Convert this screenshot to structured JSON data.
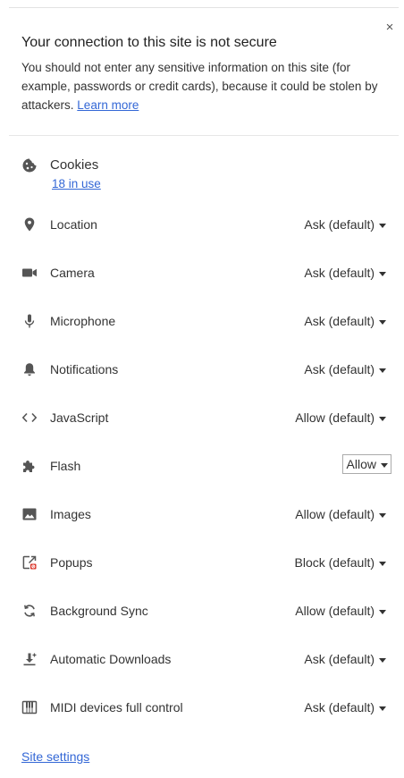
{
  "header": {
    "close_glyph": "×",
    "title": "Your connection to this site is not secure",
    "description": "You should not enter any sensitive information on this site (for example, passwords or credit cards), because it could be stolen by attackers.",
    "learn_more": "Learn more"
  },
  "cookies": {
    "label": "Cookies",
    "in_use": "18 in use",
    "icon": "cookie-icon"
  },
  "permissions": [
    {
      "label": "Location",
      "value": "Ask (default)",
      "icon": "location-pin-icon"
    },
    {
      "label": "Camera",
      "value": "Ask (default)",
      "icon": "camera-icon"
    },
    {
      "label": "Microphone",
      "value": "Ask (default)",
      "icon": "microphone-icon"
    },
    {
      "label": "Notifications",
      "value": "Ask (default)",
      "icon": "bell-icon"
    },
    {
      "label": "JavaScript",
      "value": "Allow (default)",
      "icon": "code-icon"
    },
    {
      "label": "Flash",
      "value": "Allow",
      "icon": "puzzle-icon"
    },
    {
      "label": "Images",
      "value": "Allow (default)",
      "icon": "image-icon"
    },
    {
      "label": "Popups",
      "value": "Block (default)",
      "icon": "popup-blocked-icon"
    },
    {
      "label": "Background Sync",
      "value": "Allow (default)",
      "icon": "sync-icon"
    },
    {
      "label": "Automatic Downloads",
      "value": "Ask (default)",
      "icon": "download-icon"
    },
    {
      "label": "MIDI devices full control",
      "value": "Ask (default)",
      "icon": "midi-icon"
    }
  ],
  "footer": {
    "site_settings": "Site settings"
  },
  "colors": {
    "link": "#3367d6",
    "text": "#333333",
    "popup_badge": "#d93025"
  }
}
